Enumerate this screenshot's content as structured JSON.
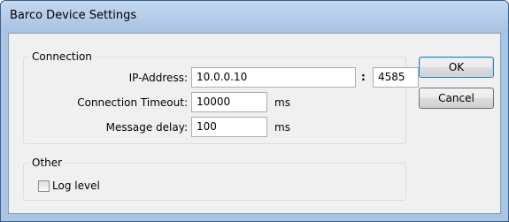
{
  "window": {
    "title": "Barco Device Settings"
  },
  "connection": {
    "group_label": "Connection",
    "ip_label": "IP-Address:",
    "ip_value": "10.0.0.10",
    "port_separator": ":",
    "port_value": "4585",
    "timeout_label": "Connection Timeout:",
    "timeout_value": "10000",
    "timeout_unit": "ms",
    "delay_label": "Message delay:",
    "delay_value": "100",
    "delay_unit": "ms"
  },
  "other": {
    "group_label": "Other",
    "log_level_label": "Log level",
    "log_level_checked": false
  },
  "buttons": {
    "ok": "OK",
    "cancel": "Cancel"
  }
}
